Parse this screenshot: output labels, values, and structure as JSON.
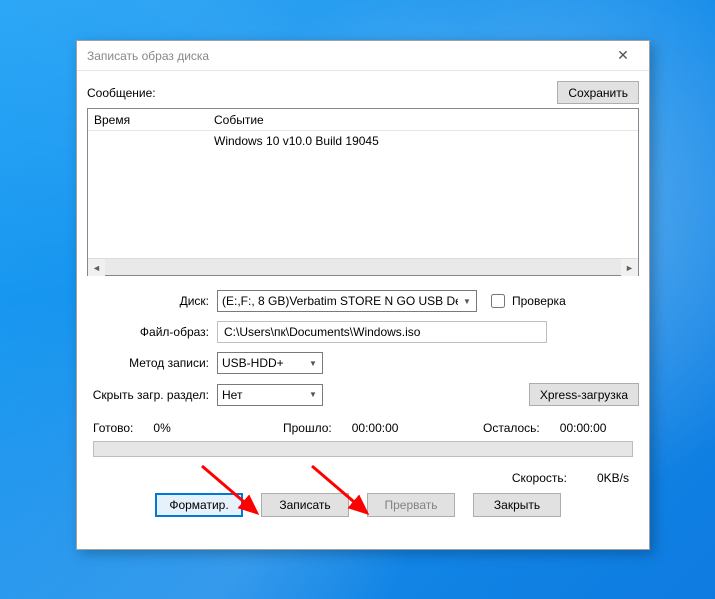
{
  "window": {
    "title": "Записать образ диска"
  },
  "message": {
    "label": "Сообщение:",
    "save_btn": "Сохранить"
  },
  "log": {
    "col_time": "Время",
    "col_event": "Событие",
    "rows": [
      {
        "time": "",
        "event": "Windows 10 v10.0 Build 19045"
      }
    ]
  },
  "form": {
    "disk_label": "Диск:",
    "disk_value": "(E:,F:, 8 GB)Verbatim STORE N GO USB Devi",
    "check_label": "Проверка",
    "file_label": "Файл-образ:",
    "file_value": "C:\\Users\\пк\\Documents\\Windows.iso",
    "method_label": "Метод записи:",
    "method_value": "USB-HDD+",
    "hide_label": "Скрыть загр. раздел:",
    "hide_value": "Нет",
    "xpress_btn": "Xpress-загрузка"
  },
  "status": {
    "ready_label": "Готово:",
    "ready_value": "0%",
    "elapsed_label": "Прошло:",
    "elapsed_value": "00:00:00",
    "remaining_label": "Осталось:",
    "remaining_value": "00:00:00",
    "speed_label": "Скорость:",
    "speed_value": "0KB/s"
  },
  "buttons": {
    "format": "Форматир.",
    "write": "Записать",
    "abort": "Прервать",
    "close": "Закрыть"
  }
}
